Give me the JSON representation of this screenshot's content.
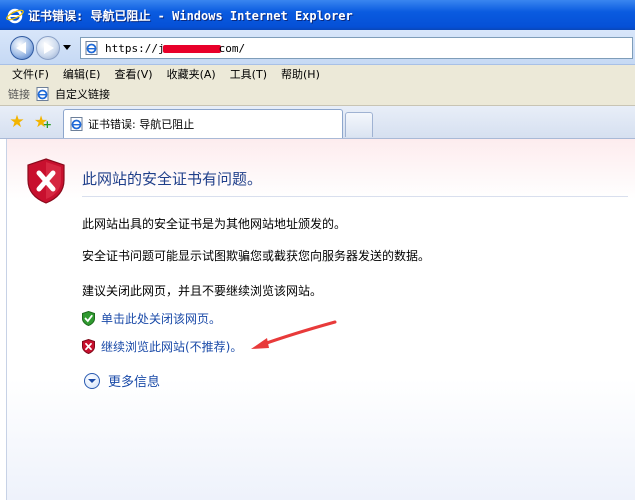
{
  "window": {
    "title": "证书错误: 导航已阻止 - Windows Internet Explorer"
  },
  "address": {
    "prefix": "https://j",
    "suffix": "com/"
  },
  "menu": [
    "文件(F)",
    "编辑(E)",
    "查看(V)",
    "收藏夹(A)",
    "工具(T)",
    "帮助(H)"
  ],
  "links_bar": {
    "label": "链接",
    "item": "自定义链接"
  },
  "tab": {
    "label": "证书错误: 导航已阻止"
  },
  "content": {
    "heading": "此网站的安全证书有问题。",
    "p1": "此网站出具的安全证书是为其他网站地址颁发的。",
    "p2": "安全证书问题可能显示试图欺骗您或截获您向服务器发送的数据。",
    "p3": "建议关闭此网页，并且不要继续浏览该网站。",
    "close_link": "单击此处关闭该网页。",
    "continue_link": "继续浏览此网站(不推荐)。",
    "more_info": "更多信息"
  },
  "colors": {
    "title_bar": "#0550d6",
    "link": "#1a4aa8",
    "heading": "#1f3f8a",
    "annotation_arrow": "#e83a3a",
    "shield_red": "#c8102e"
  },
  "icons": [
    "ie-logo-icon",
    "back-icon",
    "forward-icon",
    "page-icon",
    "favorites-star-icon",
    "add-favorites-icon",
    "error-shield-icon",
    "green-shield-icon",
    "red-shield-icon",
    "expand-arrow-icon"
  ]
}
